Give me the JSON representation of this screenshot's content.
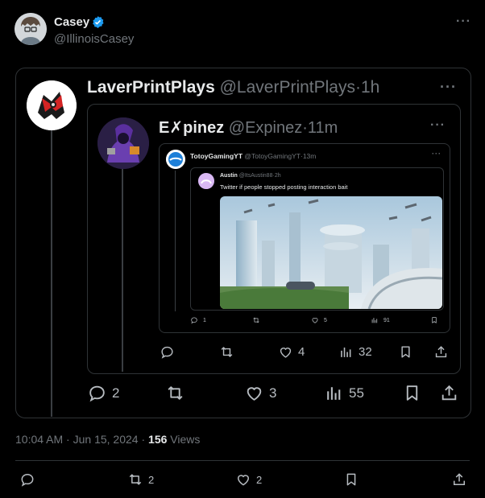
{
  "author": {
    "name": "Casey",
    "handle": "@IllinoisCasey"
  },
  "quote1": {
    "name": "LaverPrintPlays",
    "handle": "@LaverPrintPlays",
    "time": "1h",
    "replies": "2",
    "reposts": "",
    "likes": "3",
    "views": "55"
  },
  "quote2": {
    "name": "E✗pinez",
    "handle": "@Expinez",
    "time": "11m",
    "replies": "",
    "reposts": "",
    "likes": "4",
    "views": "32"
  },
  "quote3": {
    "name": "TotoyGamingYT",
    "handle": "@TotoyGamingYT",
    "time": "13m",
    "replies": "1",
    "reposts": "",
    "likes": "5",
    "views": "91"
  },
  "quote4": {
    "name": "Austin",
    "handle": "@ItsAustin88",
    "time": "2h",
    "text": "Twitter if people stopped posting interaction bait"
  },
  "meta": {
    "time": "10:04 AM",
    "date": "Jun 15, 2024",
    "views_count": "156",
    "views_label": "Views"
  },
  "bottom": {
    "reposts": "2",
    "likes": "2"
  },
  "separator": "·",
  "more_label": "···",
  "icons": [
    "verified-badge-icon",
    "reply-icon",
    "repost-icon",
    "like-icon",
    "views-icon",
    "bookmark-icon",
    "share-icon",
    "more-icon"
  ],
  "colors": {
    "verified": "#1d9bf0",
    "muted": "#71767b",
    "border": "#2f3336"
  }
}
